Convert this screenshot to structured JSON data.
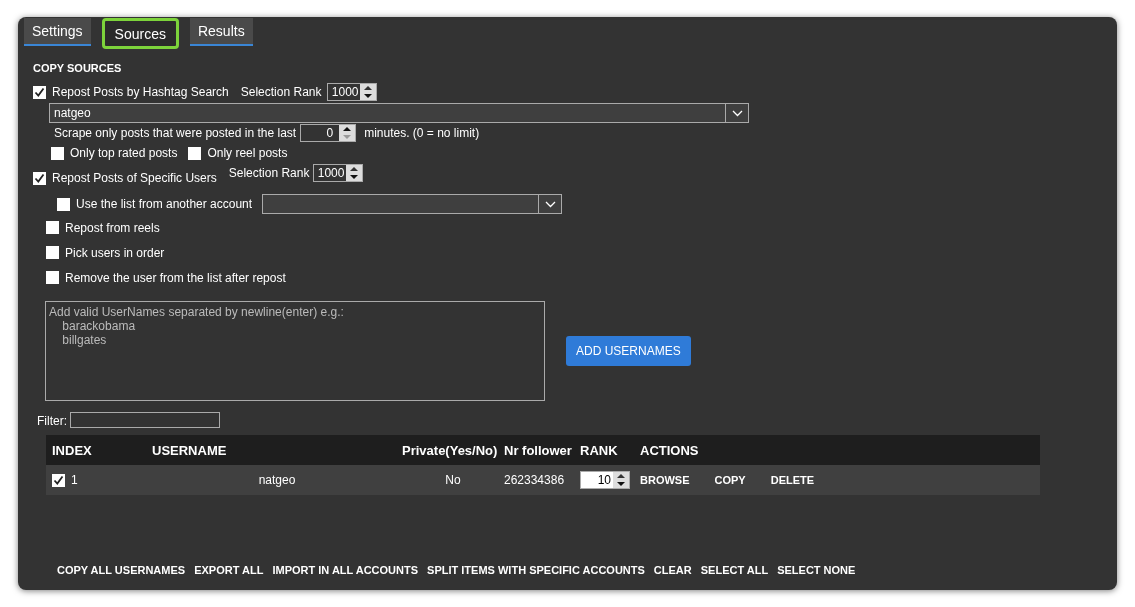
{
  "tabs": [
    {
      "label": "Settings",
      "selected": false
    },
    {
      "label": "Sources",
      "selected": true
    },
    {
      "label": "Results",
      "selected": false
    }
  ],
  "section_title": "COPY SOURCES",
  "hashtag": {
    "label": "Repost Posts by Hashtag Search",
    "checked": true,
    "rank_label": "Selection Rank",
    "rank": "1000",
    "value": "natgeo",
    "scrape_label": "Scrape only posts that were posted in the last",
    "minutes": "0",
    "minutes_suffix": "minutes. (0 = no limit)",
    "options": [
      {
        "label": "Only top rated posts",
        "checked": false
      },
      {
        "label": "Only reel posts",
        "checked": false
      }
    ]
  },
  "users": {
    "label": "Repost Posts of Specific Users",
    "checked": true,
    "rank_label": "Selection Rank",
    "rank": "1000",
    "another_account": {
      "label": "Use the list from another account",
      "checked": false
    },
    "options": [
      {
        "label": "Repost from reels",
        "checked": false
      },
      {
        "label": "Pick users in order",
        "checked": false
      },
      {
        "label": "Remove the user from the list after repost",
        "checked": false
      }
    ],
    "usernames_placeholder": "Add valid UserNames separated by newline(enter) e.g.:\n    barackobama\n    billgates",
    "add_button": "ADD USERNAMES"
  },
  "filter_label": "Filter:",
  "table": {
    "columns": [
      "INDEX",
      "USERNAME",
      "Private(Yes/No)",
      "Nr follower",
      "RANK",
      "ACTIONS"
    ],
    "rows": [
      {
        "checked": true,
        "index": "1",
        "username": "natgeo",
        "private": "No",
        "followers": "262334386",
        "rank": "10",
        "actions": [
          "BROWSE",
          "COPY",
          "DELETE"
        ]
      }
    ]
  },
  "footer_buttons": [
    "COPY ALL USERNAMES",
    "EXPORT ALL",
    "IMPORT IN ALL ACCOUNTS",
    "SPLIT ITEMS WITH SPECIFIC ACCOUNTS",
    "CLEAR",
    "SELECT ALL",
    "SELECT NONE"
  ]
}
